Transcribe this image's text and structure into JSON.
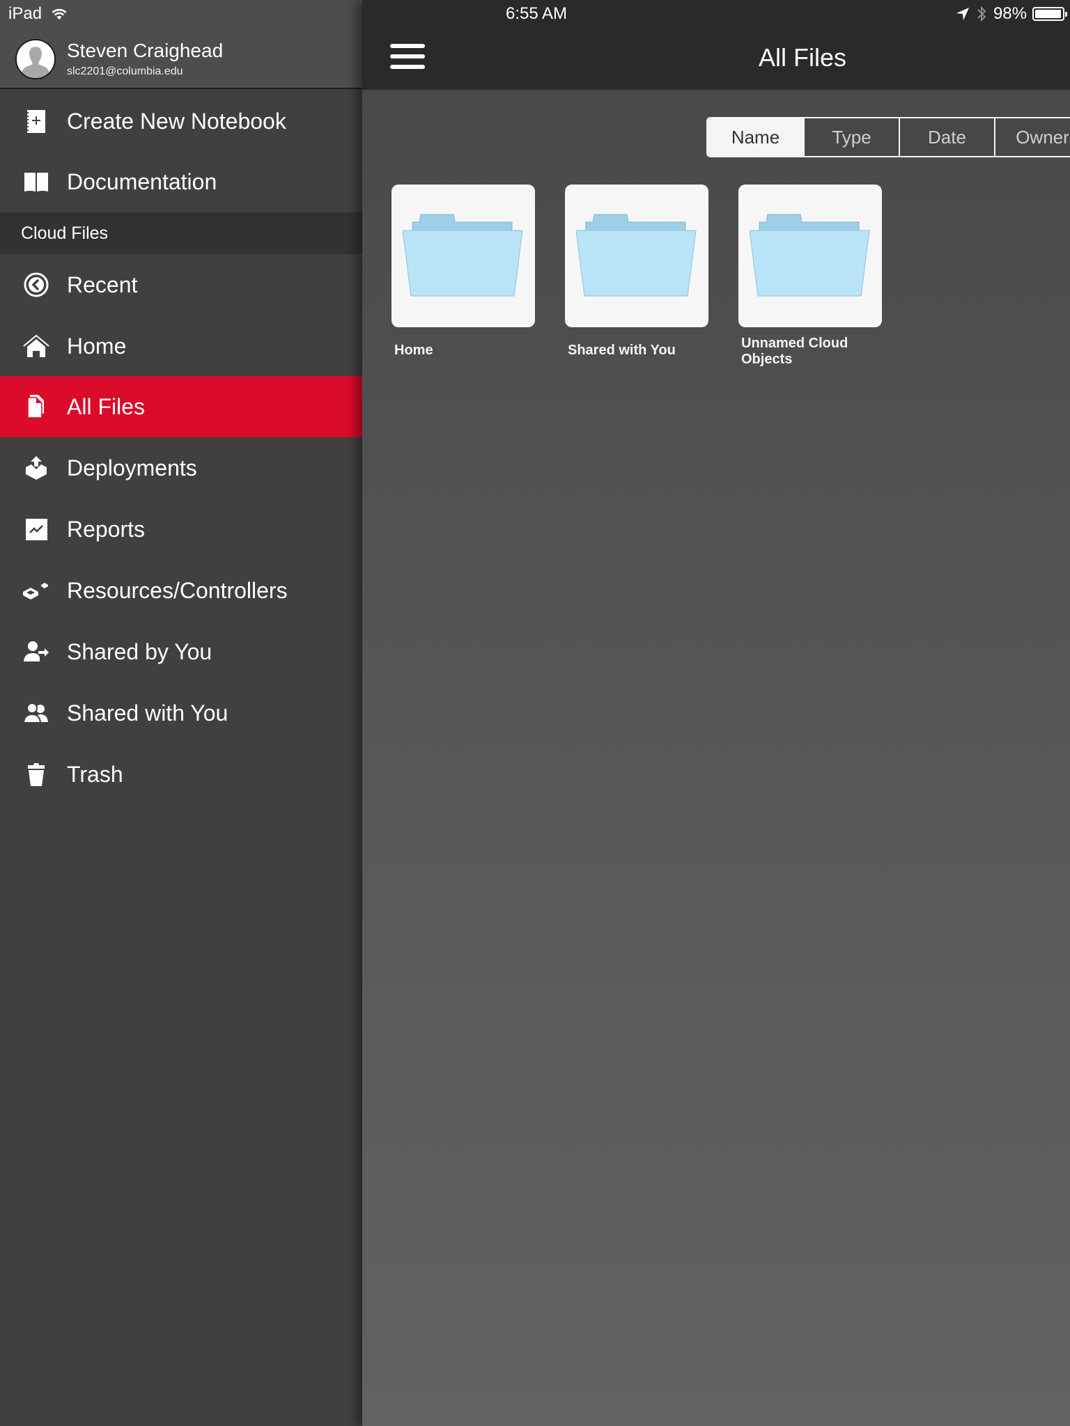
{
  "status_bar": {
    "device": "iPad",
    "time": "6:55 AM",
    "battery": "98%",
    "battery_level": 0.98
  },
  "user": {
    "name": "Steven Craighead",
    "email": "slc2201@columbia.edu"
  },
  "sidebar": {
    "top_items": [
      {
        "label": "Create New Notebook",
        "icon": "new-notebook-icon"
      },
      {
        "label": "Documentation",
        "icon": "book-icon"
      }
    ],
    "section_header": "Cloud Files",
    "items": [
      {
        "label": "Recent",
        "icon": "clock-icon",
        "active": false
      },
      {
        "label": "Home",
        "icon": "home-icon",
        "active": false
      },
      {
        "label": "All Files",
        "icon": "files-icon",
        "active": true
      },
      {
        "label": "Deployments",
        "icon": "deploy-icon",
        "active": false
      },
      {
        "label": "Reports",
        "icon": "chart-icon",
        "active": false
      },
      {
        "label": "Resources/Controllers",
        "icon": "cubes-icon",
        "active": false
      },
      {
        "label": "Shared by You",
        "icon": "user-share-icon",
        "active": false
      },
      {
        "label": "Shared with You",
        "icon": "users-icon",
        "active": false
      },
      {
        "label": "Trash",
        "icon": "trash-icon",
        "active": false
      }
    ],
    "active_color": "#db0b2b"
  },
  "main": {
    "title": "All Files",
    "sort_options": [
      "Name",
      "Type",
      "Date",
      "Owner"
    ],
    "sort_selected": "Name",
    "folders": [
      {
        "name": "Home"
      },
      {
        "name": "Shared with You"
      },
      {
        "name": "Unnamed Cloud Objects"
      }
    ]
  }
}
